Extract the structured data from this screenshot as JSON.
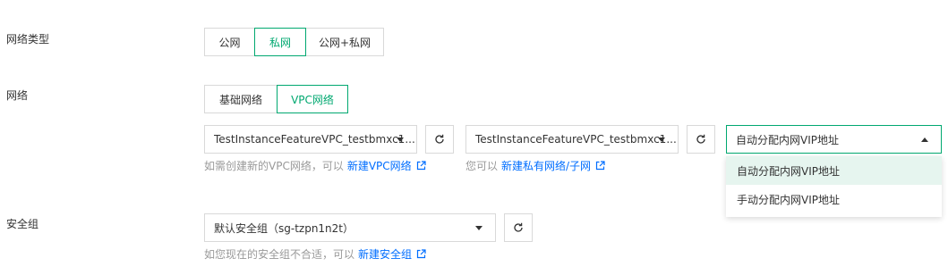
{
  "network_type": {
    "label": "网络类型",
    "options": [
      "公网",
      "私网",
      "公网+私网"
    ],
    "selected": "私网"
  },
  "network": {
    "label": "网络",
    "options": [
      "基础网络",
      "VPC网络"
    ],
    "selected": "VPC网络",
    "vpc_select": {
      "value": "TestInstanceFeatureVPC_testbmxc1..."
    },
    "subnet_select": {
      "value": "TestInstanceFeatureVPC_testbmxc1..."
    },
    "vip_select": {
      "value": "自动分配内网VIP地址",
      "options": [
        "自动分配内网VIP地址",
        "手动分配内网VIP地址"
      ]
    },
    "vpc_hint": {
      "text": "如需创建新的VPC网络，可以",
      "link": "新建VPC网络"
    },
    "subnet_hint": {
      "text": "您可以",
      "link": "新建私有网络/子网"
    }
  },
  "security_group": {
    "label": "安全组",
    "select": {
      "value": "默认安全组（sg-tzpn1n2t）"
    },
    "hint": {
      "text": "如您现在的安全组不合适，可以",
      "link": "新建安全组"
    }
  },
  "colors": {
    "accent": "#00a870",
    "link": "#006eff",
    "hint": "#999999",
    "border": "#d9d9d9"
  },
  "icons": [
    "refresh-icon",
    "external-link-icon",
    "caret-down-icon",
    "caret-up-icon"
  ]
}
